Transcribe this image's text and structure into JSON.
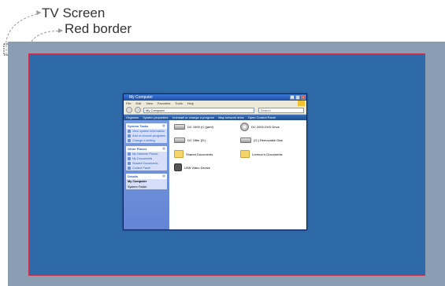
{
  "annotations": {
    "tv_screen": "TV Screen",
    "red_border": "Red border"
  },
  "colors": {
    "tv_screen": "#8a9db3",
    "desktop_blue": "#2f6aa8",
    "red_border": "#c8304a"
  },
  "window": {
    "title": "My Computer",
    "menu": [
      "File",
      "Edit",
      "View",
      "Favorites",
      "Tools",
      "Help"
    ],
    "address": "My Computer",
    "search_placeholder": "Search",
    "commands": [
      "Organize",
      "System properties",
      "Uninstall or change a program",
      "Map network drive",
      "Open Control Panel"
    ],
    "system_tasks": {
      "title": "System Tasks",
      "items": [
        "View system information",
        "Add or remove programs",
        "Change a setting"
      ]
    },
    "other_places": {
      "title": "Other Places",
      "items": [
        "My Network Places",
        "My Documents",
        "Shared Documents",
        "Control Panel"
      ]
    },
    "details": {
      "title": "Details",
      "name": "My Computer",
      "sub": "System Folder"
    },
    "items": [
      {
        "label": "DC 1500 (C:)(amf)",
        "icon": "hard-drive-icon"
      },
      {
        "label": "DC 2000 DVD Drive",
        "icon": "dvd-drive-icon"
      },
      {
        "label": "DC Offer (D:)",
        "icon": "hard-drive-icon"
      },
      {
        "label": "(G:) Removable Disk",
        "icon": "removable-disk-icon"
      },
      {
        "label": "Shared Documents",
        "icon": "folder-icon"
      },
      {
        "label": "Lorenzo's Documents",
        "icon": "folder-icon"
      },
      {
        "label": "USB Video Device",
        "icon": "camera-icon"
      }
    ]
  }
}
